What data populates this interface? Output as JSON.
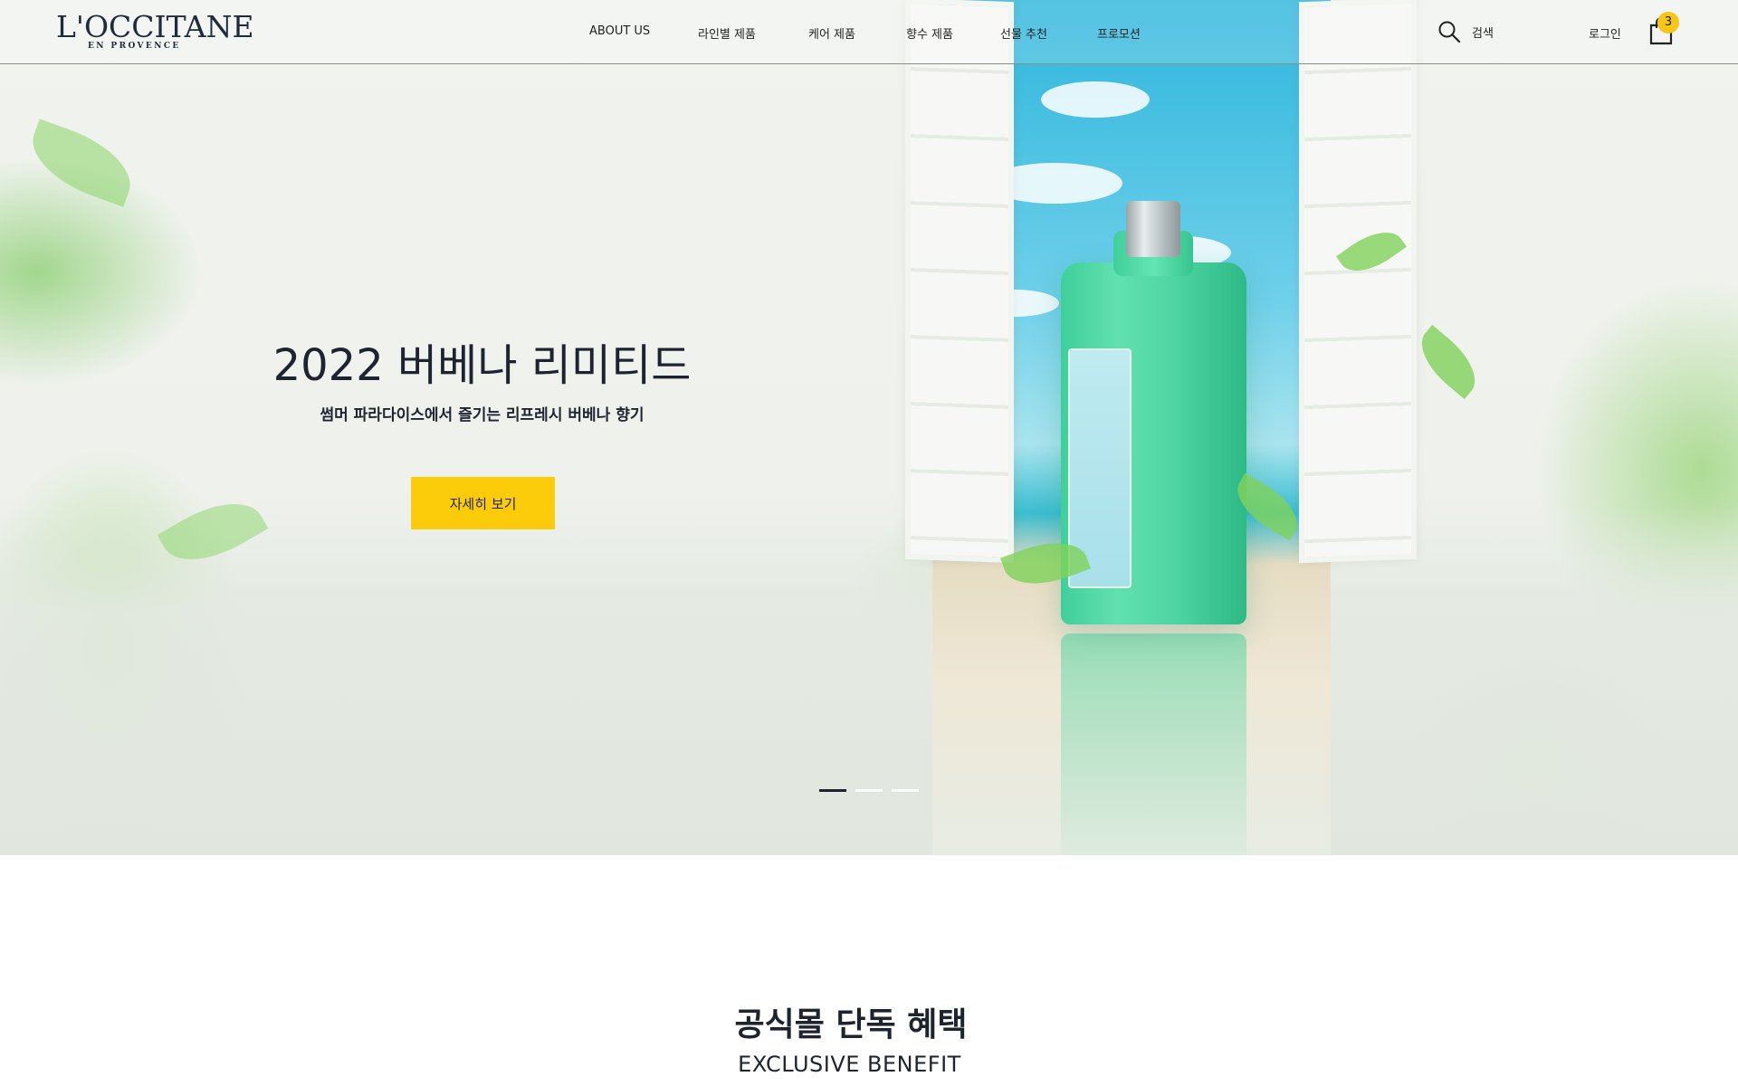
{
  "brand": {
    "logo_main": "L'OCCITANE",
    "logo_sub": "EN PROVENCE"
  },
  "nav": {
    "items": [
      {
        "label": "ABOUT US"
      },
      {
        "label": "라인별 제품"
      },
      {
        "label": "케어 제품"
      },
      {
        "label": "향수 제품"
      },
      {
        "label": "선물 추천"
      },
      {
        "label": "프로모션"
      }
    ]
  },
  "utility": {
    "search_label": "검색",
    "login_label": "로그인",
    "cart_count": "3",
    "search_icon": "search-icon",
    "cart_icon": "shopping-bag-icon"
  },
  "hero": {
    "title": "2022 버베나 리미티드",
    "subtitle": "썸머 파라다이스에서 즐기는 리프레시 버베나 향기",
    "button_label": "자세히 보기",
    "slides_total": 3,
    "active_slide": 1
  },
  "benefit": {
    "title": "공식몰 단독 혜택",
    "subtitle": "EXCLUSIVE BENEFIT"
  },
  "colors": {
    "accent": "#fccc0a",
    "text_dark": "#1d2430",
    "badge": "#f6c515"
  }
}
